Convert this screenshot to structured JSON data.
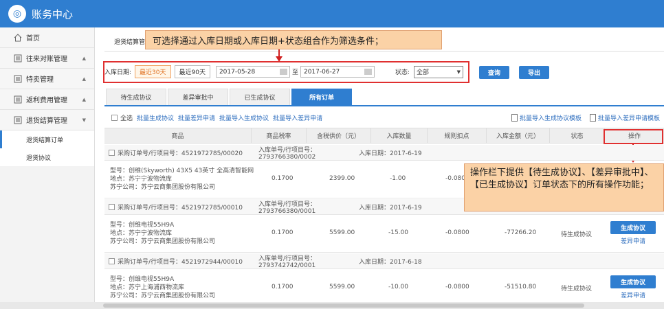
{
  "app": {
    "title": "账务中心",
    "logo_glyph": "◎"
  },
  "sidebar": {
    "items": [
      {
        "label": "首页",
        "icon": "home-icon"
      },
      {
        "label": "往来对账管理",
        "icon": "list-icon"
      },
      {
        "label": "特卖管理",
        "icon": "list-icon"
      },
      {
        "label": "返利费用管理",
        "icon": "list-icon"
      },
      {
        "label": "退货结算管理",
        "icon": "list-icon"
      }
    ],
    "subitems": [
      {
        "label": "退货结算订单",
        "active": true
      },
      {
        "label": "退货协议",
        "active": false
      }
    ]
  },
  "breadcrumb": "退货结算管",
  "filter": {
    "date_label": "入库日期:",
    "recent30": "最近30天",
    "recent90": "最近90天",
    "start": "2017-05-28",
    "to": "至",
    "end": "2017-06-27",
    "status_label": "状态:",
    "status_value": "全部",
    "query": "查询",
    "export": "导出"
  },
  "tips": {
    "filter": "可选择通过入库日期或入库日期+状态组合作为筛选条件；",
    "ops": "操作栏下提供【待生成协议】、【差异审批中】、【已生成协议】订单状态下的所有操作功能；"
  },
  "tabs": [
    {
      "label": "待生成协议",
      "active": false
    },
    {
      "label": "差异审批中",
      "active": false
    },
    {
      "label": "已生成协议",
      "active": false
    },
    {
      "label": "所有订单",
      "active": true
    }
  ],
  "bulk": {
    "select_all": "全选",
    "gen": "批量生成协议",
    "diff": "批量差异申请",
    "import_gen": "批量导入生成协议",
    "import_diff": "批量导入差异申请",
    "tpl_gen": "批量导入生成协议模板",
    "tpl_diff": "批量导入差异申请模板"
  },
  "columns": [
    "商品",
    "商品税率",
    "含税供价（元）",
    "入库数量",
    "规则扣点",
    "入库金额（元）",
    "状态",
    "操作"
  ],
  "orders": [
    {
      "po": "采购订单号/行项目号：4521972785/00020",
      "ru": "入库单号/行项目号：2793766380/0002",
      "date": "入库日期：2017-6-19",
      "model": "型号：创维(Skyworth) 43X5 43英寸 全高清智能网",
      "location": "地点：苏宁宁波物流库",
      "company": "苏宁公司：苏宁云商集团股份有限公司",
      "tax": "0.1700",
      "price": "2399.00",
      "qty": "-1.00",
      "deduct": "-0.080",
      "amount": "",
      "status": "",
      "op_gen": "",
      "op_diff": ""
    },
    {
      "po": "采购订单号/行项目号：4521972785/00010",
      "ru": "入库单号/行项目号：2793766380/0001",
      "date": "入库日期：2017-6-19",
      "model": "型号：创维电视55H9A",
      "location": "地点：苏宁宁波物流库",
      "company": "苏宁公司：苏宁云商集团股份有限公司",
      "tax": "0.1700",
      "price": "5599.00",
      "qty": "-15.00",
      "deduct": "-0.0800",
      "amount": "-77266.20",
      "status": "待生成协议",
      "op_gen": "生成协议",
      "op_diff": "差异申请"
    },
    {
      "po": "采购订单号/行项目号：4521972944/00010",
      "ru": "入库单号/行项目号：2793742742/0001",
      "date": "入库日期：2017-6-18",
      "model": "型号：创维电视55H9A",
      "location": "地点：苏宁上海浦西物流库",
      "company": "苏宁公司：苏宁云商集团股份有限公司",
      "tax": "0.1700",
      "price": "5599.00",
      "qty": "-10.00",
      "deduct": "-0.0800",
      "amount": "-51510.80",
      "status": "待生成协议",
      "op_gen": "生成协议",
      "op_diff": "差异申请"
    }
  ],
  "colors": {
    "primary": "#2f7ed0",
    "highlight_red": "#e03030",
    "tip_bg": "#fbd2a6"
  }
}
